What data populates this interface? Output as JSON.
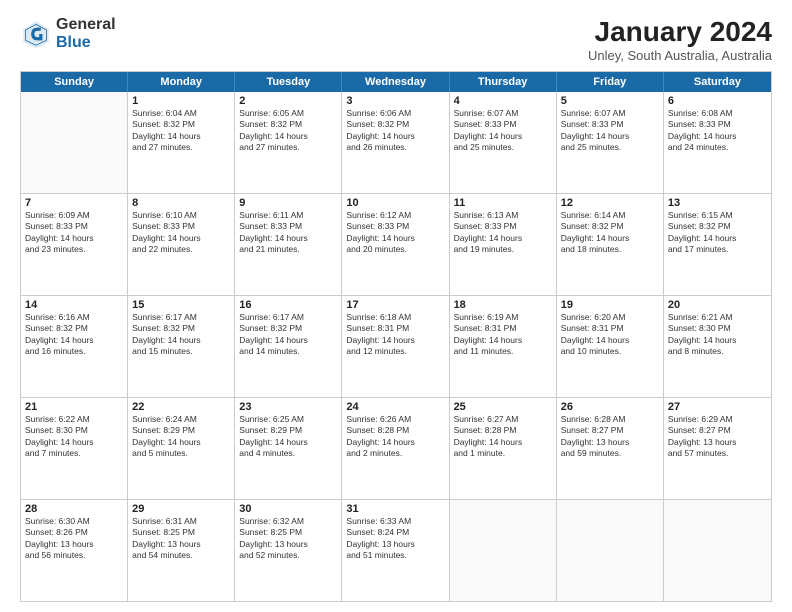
{
  "header": {
    "logo_general": "General",
    "logo_blue": "Blue",
    "month_year": "January 2024",
    "location": "Unley, South Australia, Australia"
  },
  "days_of_week": [
    "Sunday",
    "Monday",
    "Tuesday",
    "Wednesday",
    "Thursday",
    "Friday",
    "Saturday"
  ],
  "weeks": [
    [
      {
        "day": "",
        "lines": []
      },
      {
        "day": "1",
        "lines": [
          "Sunrise: 6:04 AM",
          "Sunset: 8:32 PM",
          "Daylight: 14 hours",
          "and 27 minutes."
        ]
      },
      {
        "day": "2",
        "lines": [
          "Sunrise: 6:05 AM",
          "Sunset: 8:32 PM",
          "Daylight: 14 hours",
          "and 27 minutes."
        ]
      },
      {
        "day": "3",
        "lines": [
          "Sunrise: 6:06 AM",
          "Sunset: 8:32 PM",
          "Daylight: 14 hours",
          "and 26 minutes."
        ]
      },
      {
        "day": "4",
        "lines": [
          "Sunrise: 6:07 AM",
          "Sunset: 8:33 PM",
          "Daylight: 14 hours",
          "and 25 minutes."
        ]
      },
      {
        "day": "5",
        "lines": [
          "Sunrise: 6:07 AM",
          "Sunset: 8:33 PM",
          "Daylight: 14 hours",
          "and 25 minutes."
        ]
      },
      {
        "day": "6",
        "lines": [
          "Sunrise: 6:08 AM",
          "Sunset: 8:33 PM",
          "Daylight: 14 hours",
          "and 24 minutes."
        ]
      }
    ],
    [
      {
        "day": "7",
        "lines": [
          "Sunrise: 6:09 AM",
          "Sunset: 8:33 PM",
          "Daylight: 14 hours",
          "and 23 minutes."
        ]
      },
      {
        "day": "8",
        "lines": [
          "Sunrise: 6:10 AM",
          "Sunset: 8:33 PM",
          "Daylight: 14 hours",
          "and 22 minutes."
        ]
      },
      {
        "day": "9",
        "lines": [
          "Sunrise: 6:11 AM",
          "Sunset: 8:33 PM",
          "Daylight: 14 hours",
          "and 21 minutes."
        ]
      },
      {
        "day": "10",
        "lines": [
          "Sunrise: 6:12 AM",
          "Sunset: 8:33 PM",
          "Daylight: 14 hours",
          "and 20 minutes."
        ]
      },
      {
        "day": "11",
        "lines": [
          "Sunrise: 6:13 AM",
          "Sunset: 8:33 PM",
          "Daylight: 14 hours",
          "and 19 minutes."
        ]
      },
      {
        "day": "12",
        "lines": [
          "Sunrise: 6:14 AM",
          "Sunset: 8:32 PM",
          "Daylight: 14 hours",
          "and 18 minutes."
        ]
      },
      {
        "day": "13",
        "lines": [
          "Sunrise: 6:15 AM",
          "Sunset: 8:32 PM",
          "Daylight: 14 hours",
          "and 17 minutes."
        ]
      }
    ],
    [
      {
        "day": "14",
        "lines": [
          "Sunrise: 6:16 AM",
          "Sunset: 8:32 PM",
          "Daylight: 14 hours",
          "and 16 minutes."
        ]
      },
      {
        "day": "15",
        "lines": [
          "Sunrise: 6:17 AM",
          "Sunset: 8:32 PM",
          "Daylight: 14 hours",
          "and 15 minutes."
        ]
      },
      {
        "day": "16",
        "lines": [
          "Sunrise: 6:17 AM",
          "Sunset: 8:32 PM",
          "Daylight: 14 hours",
          "and 14 minutes."
        ]
      },
      {
        "day": "17",
        "lines": [
          "Sunrise: 6:18 AM",
          "Sunset: 8:31 PM",
          "Daylight: 14 hours",
          "and 12 minutes."
        ]
      },
      {
        "day": "18",
        "lines": [
          "Sunrise: 6:19 AM",
          "Sunset: 8:31 PM",
          "Daylight: 14 hours",
          "and 11 minutes."
        ]
      },
      {
        "day": "19",
        "lines": [
          "Sunrise: 6:20 AM",
          "Sunset: 8:31 PM",
          "Daylight: 14 hours",
          "and 10 minutes."
        ]
      },
      {
        "day": "20",
        "lines": [
          "Sunrise: 6:21 AM",
          "Sunset: 8:30 PM",
          "Daylight: 14 hours",
          "and 8 minutes."
        ]
      }
    ],
    [
      {
        "day": "21",
        "lines": [
          "Sunrise: 6:22 AM",
          "Sunset: 8:30 PM",
          "Daylight: 14 hours",
          "and 7 minutes."
        ]
      },
      {
        "day": "22",
        "lines": [
          "Sunrise: 6:24 AM",
          "Sunset: 8:29 PM",
          "Daylight: 14 hours",
          "and 5 minutes."
        ]
      },
      {
        "day": "23",
        "lines": [
          "Sunrise: 6:25 AM",
          "Sunset: 8:29 PM",
          "Daylight: 14 hours",
          "and 4 minutes."
        ]
      },
      {
        "day": "24",
        "lines": [
          "Sunrise: 6:26 AM",
          "Sunset: 8:28 PM",
          "Daylight: 14 hours",
          "and 2 minutes."
        ]
      },
      {
        "day": "25",
        "lines": [
          "Sunrise: 6:27 AM",
          "Sunset: 8:28 PM",
          "Daylight: 14 hours",
          "and 1 minute."
        ]
      },
      {
        "day": "26",
        "lines": [
          "Sunrise: 6:28 AM",
          "Sunset: 8:27 PM",
          "Daylight: 13 hours",
          "and 59 minutes."
        ]
      },
      {
        "day": "27",
        "lines": [
          "Sunrise: 6:29 AM",
          "Sunset: 8:27 PM",
          "Daylight: 13 hours",
          "and 57 minutes."
        ]
      }
    ],
    [
      {
        "day": "28",
        "lines": [
          "Sunrise: 6:30 AM",
          "Sunset: 8:26 PM",
          "Daylight: 13 hours",
          "and 56 minutes."
        ]
      },
      {
        "day": "29",
        "lines": [
          "Sunrise: 6:31 AM",
          "Sunset: 8:25 PM",
          "Daylight: 13 hours",
          "and 54 minutes."
        ]
      },
      {
        "day": "30",
        "lines": [
          "Sunrise: 6:32 AM",
          "Sunset: 8:25 PM",
          "Daylight: 13 hours",
          "and 52 minutes."
        ]
      },
      {
        "day": "31",
        "lines": [
          "Sunrise: 6:33 AM",
          "Sunset: 8:24 PM",
          "Daylight: 13 hours",
          "and 51 minutes."
        ]
      },
      {
        "day": "",
        "lines": []
      },
      {
        "day": "",
        "lines": []
      },
      {
        "day": "",
        "lines": []
      }
    ]
  ]
}
